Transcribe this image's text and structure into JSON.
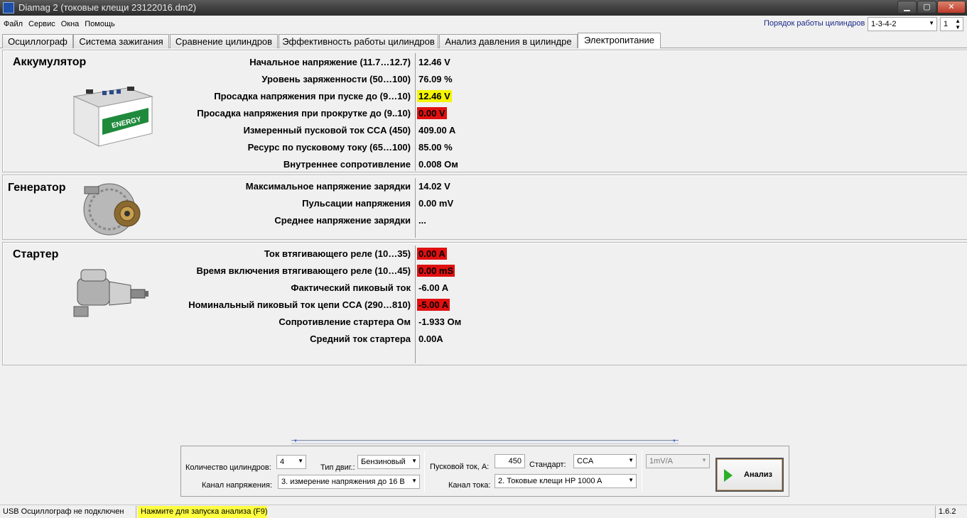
{
  "window": {
    "title": "Diamag 2 (токовые клещи 23122016.dm2)",
    "min": "▁",
    "max": "▢",
    "close": "✕"
  },
  "menu": [
    "Файл",
    "Сервис",
    "Окна",
    "Помощь"
  ],
  "cylinder_order": {
    "label": "Порядок работы цилиндров",
    "value": "1-3-4-2",
    "index_value": "1"
  },
  "tabs": [
    "Осциллограф",
    "Система зажигания",
    "Сравнение цилиндров",
    "Эффективность работы цилиндров",
    "Анализ давления в цилиндре",
    "Электропитание"
  ],
  "active_tab": "Электропитание",
  "battery": {
    "title": "Аккумулятор",
    "image_text": "ENERGY",
    "rows": [
      {
        "label": "Начальное напряжение (11.7…12.7)",
        "value": "12.46 V",
        "highlight": "none"
      },
      {
        "label": "Уровень заряженности (50…100)",
        "value": "76.09 %",
        "highlight": "none"
      },
      {
        "label": "Просадка напряжения при пуске до (9…10)",
        "value": "12.46 V",
        "highlight": "yellow"
      },
      {
        "label": "Просадка напряжения при прокрутке до  (9..10)",
        "value": "0.00 V",
        "highlight": "red"
      },
      {
        "label": "Измеренный пусковой ток  CCA (450)",
        "value": "409.00 A",
        "highlight": "none"
      },
      {
        "label": "Ресурс по пусковому току (65…100)",
        "value": "85.00 %",
        "highlight": "none"
      },
      {
        "label": "Внутреннее сопротивление",
        "value": "0.008 Ом",
        "highlight": "none"
      }
    ]
  },
  "generator": {
    "title": "Генератор",
    "rows": [
      {
        "label": "Максимальное напряжение зарядки ",
        "value": "14.02 V",
        "highlight": "none"
      },
      {
        "label": "Пульсации напряжения",
        "value": "0.00 mV",
        "highlight": "none"
      },
      {
        "label": "Среднее напряжение зарядки",
        "value": "...",
        "highlight": "none"
      }
    ]
  },
  "starter": {
    "title": "Стартер",
    "rows": [
      {
        "label": "Ток втягивающего реле (10…35)",
        "value": "0.00 A",
        "highlight": "red"
      },
      {
        "label": "Время включения втягивающего реле (10…45)",
        "value": "0.00 mS",
        "highlight": "red"
      },
      {
        "label": "Фактический пиковый ток ",
        "value": "-6.00 A",
        "highlight": "none"
      },
      {
        "label": "Номинальный пиковый ток цепи CCA (290…810)",
        "value": "-5.00 A",
        "highlight": "red"
      },
      {
        "label": "Сопротивление стартера Ом",
        "value": "-1.933 Ом",
        "highlight": "none"
      },
      {
        "label": "Средний ток стартера",
        "value": "0.00A",
        "highlight": "none"
      }
    ]
  },
  "controls": {
    "cyl_count_label": "Количество цилиндров:",
    "cyl_count_value": "4",
    "engine_type_label": "Тип двиг.:",
    "engine_type_value": "Бензиновый",
    "voltage_channel_label": "Канал напряжения:",
    "voltage_channel_value": "3. измерение напряжения до 16 В",
    "start_current_label": "Пусковой ток, А:",
    "start_current_value": "450",
    "standard_label": "Стандарт:",
    "standard_value": "CCA",
    "current_channel_label": "Канал тока:",
    "current_channel_value": "2. Токовые клещи HP 1000 A",
    "scale_value": "1mV/A",
    "analyze_label": "Анализ"
  },
  "status": {
    "usb": "USB Осциллограф не подключен",
    "hint": "Нажмите для запуска анализа (F9)",
    "version": "1.6.2"
  },
  "colors": {
    "red_highlight": "#e01010",
    "yellow_highlight": "#f5f500",
    "status_hint": "#ffff40"
  }
}
